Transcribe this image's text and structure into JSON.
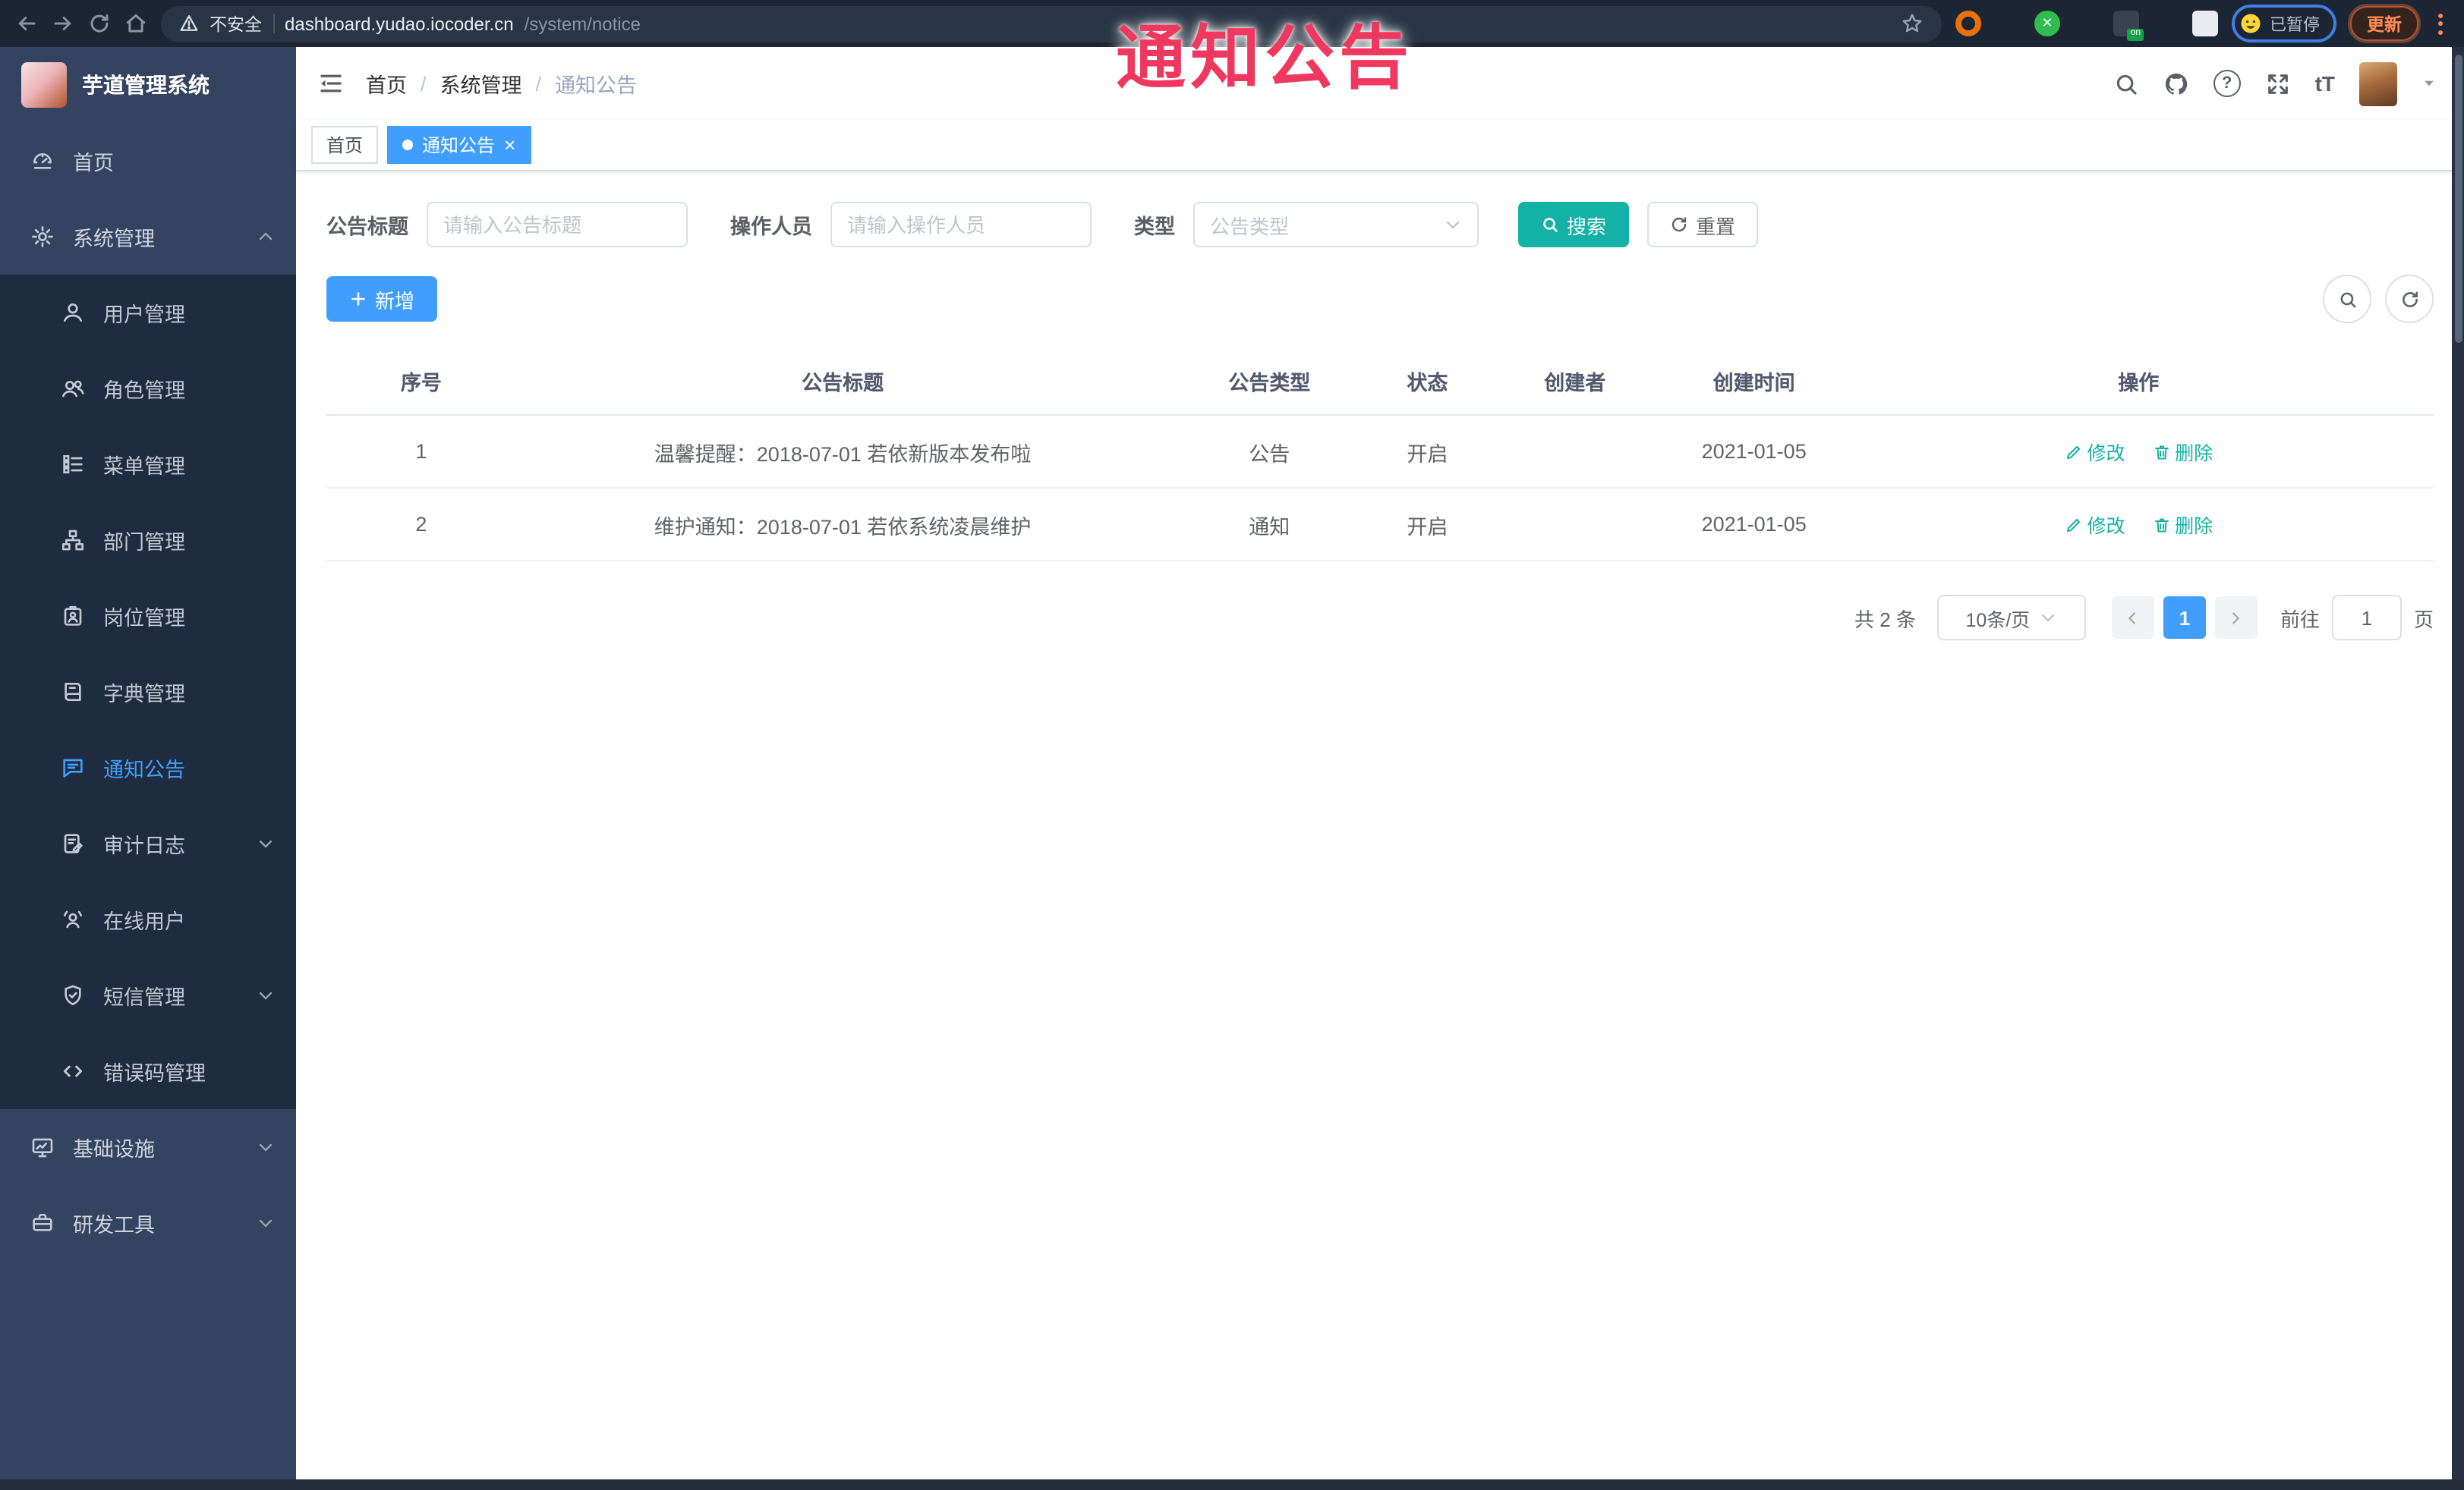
{
  "overlay": {
    "annotation": "通知公告",
    "color": "#f0385f"
  },
  "browser": {
    "insecure": "不安全",
    "url_host": "dashboard.yudao.iocoder.cn",
    "url_path": "/system/notice",
    "ext_on_badge": "on",
    "paused_label": "已暂停",
    "update_label": "更新"
  },
  "sidebar": {
    "title": "芋道管理系统",
    "items": [
      {
        "label": "首页",
        "icon": "home-icon",
        "level": "root"
      },
      {
        "label": "系统管理",
        "icon": "gear-icon",
        "level": "root",
        "expanded": true
      },
      {
        "label": "用户管理",
        "icon": "user-icon",
        "level": "sub"
      },
      {
        "label": "角色管理",
        "icon": "users-icon",
        "level": "sub"
      },
      {
        "label": "菜单管理",
        "icon": "menu-list-icon",
        "level": "sub"
      },
      {
        "label": "部门管理",
        "icon": "org-tree-icon",
        "level": "sub"
      },
      {
        "label": "岗位管理",
        "icon": "badge-icon",
        "level": "sub"
      },
      {
        "label": "字典管理",
        "icon": "book-icon",
        "level": "sub"
      },
      {
        "label": "通知公告",
        "icon": "chat-bubble-icon",
        "level": "sub",
        "active": true
      },
      {
        "label": "审计日志",
        "icon": "audit-log-icon",
        "level": "sub",
        "collapsible": true
      },
      {
        "label": "在线用户",
        "icon": "online-user-icon",
        "level": "sub"
      },
      {
        "label": "短信管理",
        "icon": "shield-icon",
        "level": "sub",
        "collapsible": true
      },
      {
        "label": "错误码管理",
        "icon": "code-icon",
        "level": "sub"
      },
      {
        "label": "基础设施",
        "icon": "monitor-icon",
        "level": "root",
        "collapsible": true
      },
      {
        "label": "研发工具",
        "icon": "toolbox-icon",
        "level": "root",
        "collapsible": true
      }
    ]
  },
  "header": {
    "breadcrumb": [
      "首页",
      "系统管理",
      "通知公告"
    ],
    "separator": "/",
    "help_glyph": "?",
    "font_size_glyph": "tT"
  },
  "tabs": [
    {
      "label": "首页",
      "active": false
    },
    {
      "label": "通知公告",
      "active": true,
      "close_glyph": "×"
    }
  ],
  "filters": {
    "title_label": "公告标题",
    "title_placeholder": "请输入公告标题",
    "operator_label": "操作人员",
    "operator_placeholder": "请输入操作人员",
    "type_label": "类型",
    "type_placeholder": "公告类型",
    "search_label": "搜索",
    "reset_label": "重置"
  },
  "toolbar": {
    "add_label": "新增"
  },
  "table": {
    "headers": [
      "序号",
      "公告标题",
      "公告类型",
      "状态",
      "创建者",
      "创建时间",
      "操作"
    ],
    "rows": [
      {
        "no": "1",
        "title": "温馨提醒：2018-07-01 若依新版本发布啦",
        "type": "公告",
        "status": "开启",
        "creator": "",
        "created": "2021-01-05"
      },
      {
        "no": "2",
        "title": "维护通知：2018-07-01 若依系统凌晨维护",
        "type": "通知",
        "status": "开启",
        "creator": "",
        "created": "2021-01-05"
      }
    ],
    "edit_label": "修改",
    "delete_label": "删除"
  },
  "pagination": {
    "total": "共 2 条",
    "page_size": "10条/页",
    "current_page": "1",
    "goto_label": "前往",
    "goto_value": "1",
    "page_unit": "页"
  },
  "colors": {
    "primary": "#409EFF",
    "teal": "#14b2a6",
    "annotation": "#f0385f",
    "sidebar_bg": "#344460",
    "submenu_bg": "#1f2b3e"
  }
}
